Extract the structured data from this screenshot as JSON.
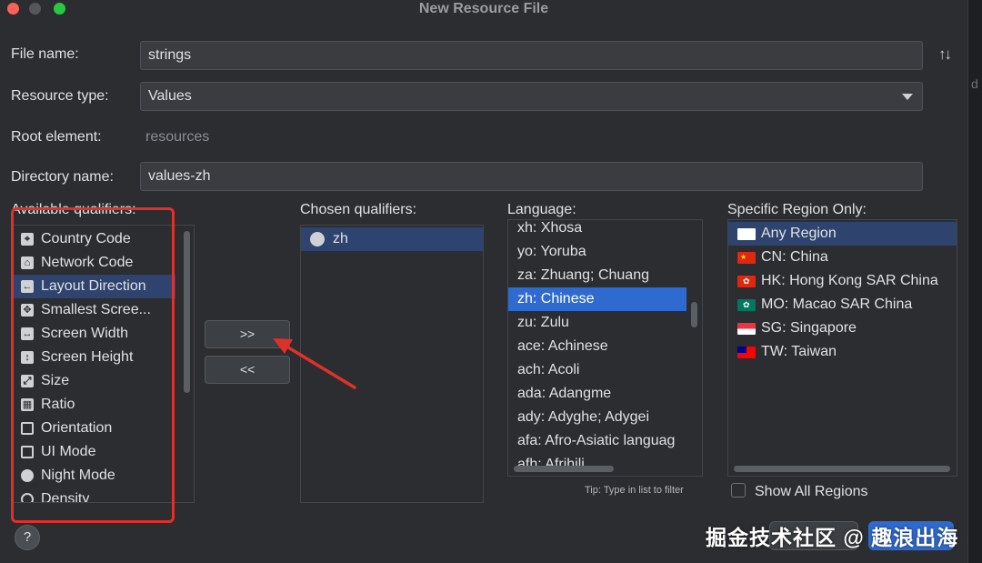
{
  "window": {
    "title": "New Resource File"
  },
  "file_name": {
    "label": "File name:",
    "value": "strings"
  },
  "resource_type": {
    "label": "Resource type:",
    "value": "Values"
  },
  "root_element": {
    "label": "Root element:",
    "value": "resources"
  },
  "directory_name": {
    "label": "Directory name:",
    "value": "values-zh"
  },
  "available_qualifiers": {
    "label": "Available qualifiers:",
    "items": [
      {
        "label": "Country Code",
        "icon": "country-code-icon"
      },
      {
        "label": "Network Code",
        "icon": "network-code-icon"
      },
      {
        "label": "Layout Direction",
        "icon": "layout-direction-icon",
        "selected": true
      },
      {
        "label": "Smallest Scree...",
        "icon": "smallest-screen-icon"
      },
      {
        "label": "Screen Width",
        "icon": "screen-width-icon"
      },
      {
        "label": "Screen Height",
        "icon": "screen-height-icon"
      },
      {
        "label": "Size",
        "icon": "size-icon"
      },
      {
        "label": "Ratio",
        "icon": "ratio-icon"
      },
      {
        "label": "Orientation",
        "icon": "orientation-icon"
      },
      {
        "label": "UI Mode",
        "icon": "ui-mode-icon"
      },
      {
        "label": "Night Mode",
        "icon": "night-mode-icon"
      },
      {
        "label": "Density",
        "icon": "density-icon"
      }
    ]
  },
  "buttons": {
    "add": ">>",
    "remove": "<<"
  },
  "chosen_qualifiers": {
    "label": "Chosen qualifiers:",
    "items": [
      {
        "label": "zh",
        "icon": "globe-icon"
      }
    ]
  },
  "language": {
    "label": "Language:",
    "items": [
      "xh: Xhosa",
      "yo: Yoruba",
      "za: Zhuang; Chuang",
      "zh: Chinese",
      "zu: Zulu",
      "ace: Achinese",
      "ach: Acoli",
      "ada: Adangme",
      "ady: Adyghe; Adygei",
      "afa: Afro-Asiatic languag",
      "afh: Afrihili"
    ],
    "selected": "zh: Chinese",
    "tip": "Tip: Type in list to filter"
  },
  "region": {
    "label": "Specific Region Only:",
    "items": [
      {
        "label": "Any Region",
        "flag": "blank",
        "selected": true
      },
      {
        "label": "CN: China",
        "flag": "cn"
      },
      {
        "label": "HK: Hong Kong SAR China",
        "flag": "hk"
      },
      {
        "label": "MO: Macao SAR China",
        "flag": "mo"
      },
      {
        "label": "SG: Singapore",
        "flag": "sg"
      },
      {
        "label": "TW: Taiwan",
        "flag": "tw"
      }
    ],
    "show_all_label": "Show All Regions"
  },
  "help": {
    "label": "?"
  },
  "watermark": "掘金技术社区 @ 趣浪出海",
  "colors": {
    "accent": "#2f6ad0",
    "annotation": "#e0302a",
    "background": "#2b2d30"
  }
}
